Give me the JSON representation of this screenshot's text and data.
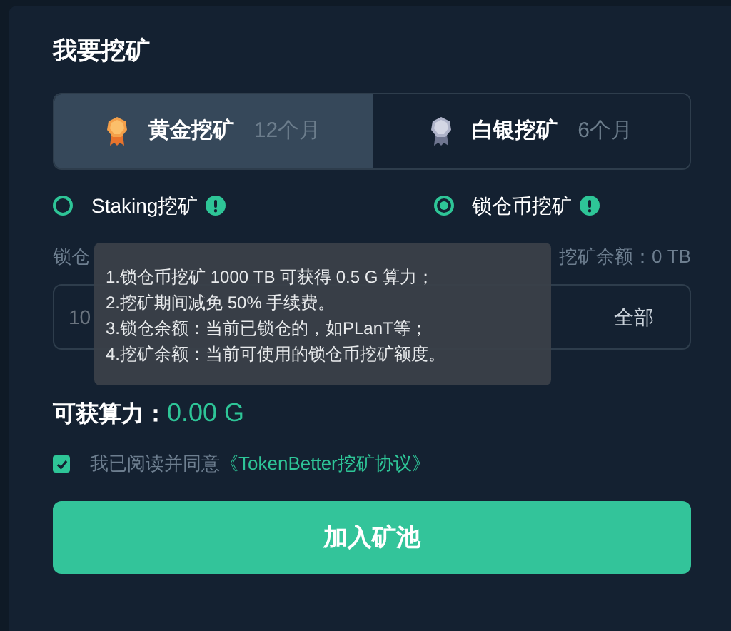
{
  "title": "我要挖矿",
  "tabs": [
    {
      "label": "黄金挖矿",
      "term": "12个月",
      "kind": "gold",
      "selected": true
    },
    {
      "label": "白银挖矿",
      "term": "6个月",
      "kind": "silver",
      "selected": false
    }
  ],
  "modes": [
    {
      "label": "Staking挖矿",
      "selected": false
    },
    {
      "label": "锁仓币挖矿",
      "selected": true
    }
  ],
  "locked_label": "锁仓",
  "mining_balance": "挖矿余额：0 TB",
  "amount_field": {
    "placeholder": "10",
    "action": "全部"
  },
  "tooltip": [
    "1.锁仓币挖矿 1000 TB 可获得 0.5 G 算力；",
    "2.挖矿期间减免 50% 手续费。",
    "3.锁仓余额：当前已锁仓的，如PLanT等；",
    "4.挖矿余额：当前可使用的锁仓币挖矿额度。"
  ],
  "hashrate": {
    "label": "可获算力：",
    "value": "0.00 G"
  },
  "agreement": {
    "checked": true,
    "text": "我已阅读并同意",
    "link": "《TokenBetter挖矿协议》"
  },
  "submit": "加入矿池"
}
